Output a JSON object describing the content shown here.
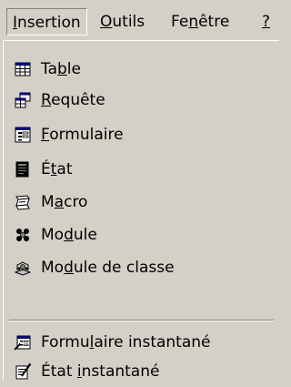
{
  "menubar": {
    "items": [
      {
        "label": "Insertion",
        "mnemonic": "I"
      },
      {
        "label": "Outils",
        "mnemonic": "O"
      },
      {
        "label": "Fenêtre",
        "mnemonic": "n"
      },
      {
        "label": "?",
        "mnemonic": "?"
      }
    ]
  },
  "menu": {
    "items": [
      {
        "label": "Table",
        "mnemonic": "b",
        "icon": "table-icon"
      },
      {
        "label": "Requête",
        "mnemonic": "R",
        "icon": "query-icon"
      },
      {
        "label": "Formulaire",
        "mnemonic": "F",
        "icon": "form-icon"
      },
      {
        "label": "État",
        "mnemonic": "t",
        "icon": "report-icon"
      },
      {
        "label": "Macro",
        "mnemonic": "a",
        "icon": "macro-icon"
      },
      {
        "label": "Module",
        "mnemonic": "d",
        "icon": "module-icon"
      },
      {
        "label": "Module de classe",
        "mnemonic": "d",
        "icon": "class-module-icon"
      },
      {
        "label": "Formulaire instantané",
        "mnemonic": "u",
        "icon": "autoform-icon"
      },
      {
        "label": "État instantané",
        "mnemonic": "i",
        "icon": "autoreport-icon"
      }
    ]
  }
}
